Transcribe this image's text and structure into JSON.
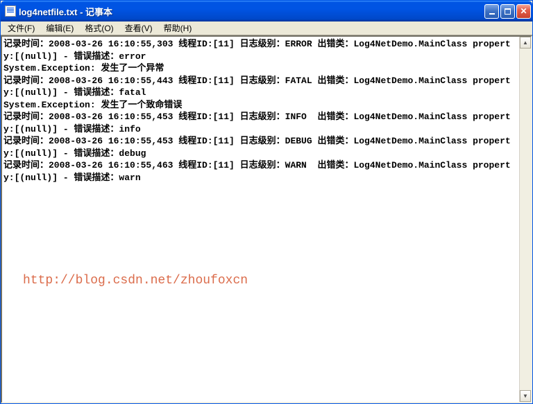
{
  "window": {
    "title": "log4netfile.txt - 记事本"
  },
  "menu": {
    "file": "文件(F)",
    "edit": "编辑(E)",
    "format": "格式(O)",
    "view": "查看(V)",
    "help": "帮助(H)"
  },
  "log_lines": [
    "记录时间：2008-03-26 16:10:55,303 线程ID:[11] 日志级别：ERROR 出错类：Log4NetDemo.MainClass property:[(null)] - 错误描述：error",
    "System.Exception: 发生了一个异常",
    "记录时间：2008-03-26 16:10:55,443 线程ID:[11] 日志级别：FATAL 出错类：Log4NetDemo.MainClass property:[(null)] - 错误描述：fatal",
    "System.Exception: 发生了一个致命错误",
    "记录时间：2008-03-26 16:10:55,453 线程ID:[11] 日志级别：INFO  出错类：Log4NetDemo.MainClass property:[(null)] - 错误描述：info",
    "记录时间：2008-03-26 16:10:55,453 线程ID:[11] 日志级别：DEBUG 出错类：Log4NetDemo.MainClass property:[(null)] - 错误描述：debug",
    "记录时间：2008-03-26 16:10:55,463 线程ID:[11] 日志级别：WARN  出错类：Log4NetDemo.MainClass property:[(null)] - 错误描述：warn"
  ],
  "watermark": "http://blog.csdn.net/zhoufoxcn"
}
